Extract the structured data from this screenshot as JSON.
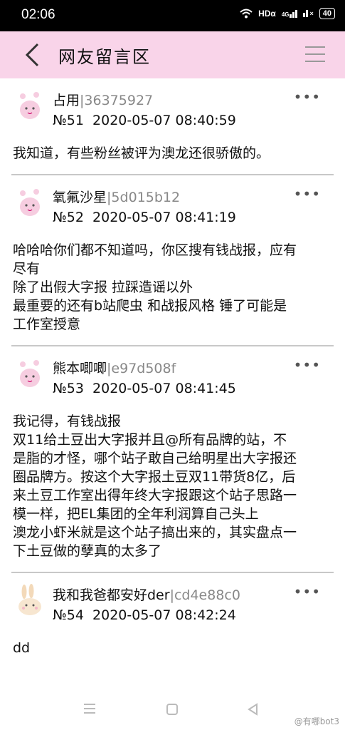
{
  "status_bar": {
    "time": "02:06",
    "network": "HDα",
    "signal": "4G",
    "battery": "40"
  },
  "header": {
    "title": "网友留言区"
  },
  "posts": [
    {
      "username": "占用",
      "user_id": "|36375927",
      "number": "№51",
      "timestamp": "2020-05-07 08:40:59",
      "lines": [
        "我知道，有些粉丝被评为澳龙还很骄傲的。"
      ]
    },
    {
      "username": "氧氟沙星",
      "user_id": "|5d015b12",
      "number": "№52",
      "timestamp": "2020-05-07 08:41:19",
      "lines": [
        "哈哈哈你们都不知道吗，你区搜有钱战报，应有",
        "尽有",
        "除了出假大字报 拉踩造谣以外",
        "最重要的还有b站爬虫 和战报风格 锤了可能是",
        "工作室授意"
      ]
    },
    {
      "username": "熊本唧唧",
      "user_id": "|e97d508f",
      "number": "№53",
      "timestamp": "2020-05-07 08:41:45",
      "lines": [
        "我记得，有钱战报",
        "双11给土豆出大字报并且@所有品牌的站，不",
        "是脂的才怪，哪个站子敢自己给明星出大字报还",
        "圈品牌方。按这个大字报土豆双11带货8亿，后",
        "来土豆工作室出得年终大字报跟这个站子思路一",
        "模一样，把EL集团的全年利润算自己头上",
        "澳龙小虾米就是这个站子搞出来的，其实盘点一",
        "下土豆做的孽真的太多了"
      ]
    },
    {
      "username": "我和我爸都安好der",
      "user_id": "|cd4e88c0",
      "number": "№54",
      "timestamp": "2020-05-07 08:42:24",
      "lines": [
        "dd"
      ]
    }
  ],
  "more_label": "•••",
  "watermark": "@有哪bot3",
  "colors": {
    "header_bg": "#f9d4e9",
    "divider": "#c8c8c8",
    "user_id": "#888888"
  }
}
